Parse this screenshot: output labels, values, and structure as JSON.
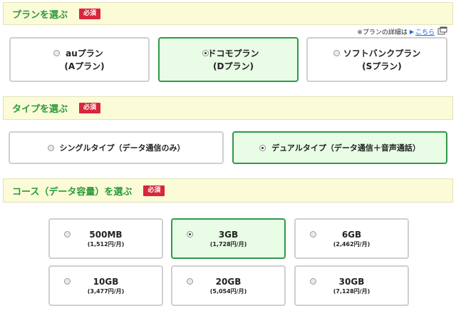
{
  "plan_section": {
    "title": "プランを選ぶ",
    "badge": "必須",
    "detail_text": "※プランの詳細は",
    "detail_link": "こちら",
    "options": [
      {
        "line1": "auプラン",
        "line2": "(Aプラン)",
        "selected": false
      },
      {
        "line1": "ドコモプラン",
        "line2": "(Dプラン)",
        "selected": true
      },
      {
        "line1": "ソフトバンクプラン",
        "line2": "(Sプラン)",
        "selected": false
      }
    ]
  },
  "type_section": {
    "title": "タイプを選ぶ",
    "badge": "必須",
    "options": [
      {
        "label": "シングルタイプ（データ通信のみ）",
        "selected": false
      },
      {
        "label": "デュアルタイプ（データ通信＋音声通話）",
        "selected": true
      }
    ]
  },
  "course_section": {
    "title": "コース（データ容量）を選ぶ",
    "badge": "必須",
    "options": [
      {
        "size": "500MB",
        "price": "(1,512円/月)",
        "selected": false
      },
      {
        "size": "3GB",
        "price": "(1,728円/月)",
        "selected": true
      },
      {
        "size": "6GB",
        "price": "(2,462円/月)",
        "selected": false
      },
      {
        "size": "10GB",
        "price": "(3,477円/月)",
        "selected": false
      },
      {
        "size": "20GB",
        "price": "(5,054円/月)",
        "selected": false
      },
      {
        "size": "30GB",
        "price": "(7,128円/月)",
        "selected": false
      }
    ]
  },
  "colors": {
    "header_bg": "#fbfbd8",
    "title_green": "#2a9a3a",
    "badge_red": "#d9263a",
    "selected_bg": "#e8fce6",
    "selected_border": "#2f9a48",
    "link_blue": "#1a6fd1"
  },
  "icons": {
    "detail_arrow": "▶",
    "external": "external-window-icon"
  }
}
